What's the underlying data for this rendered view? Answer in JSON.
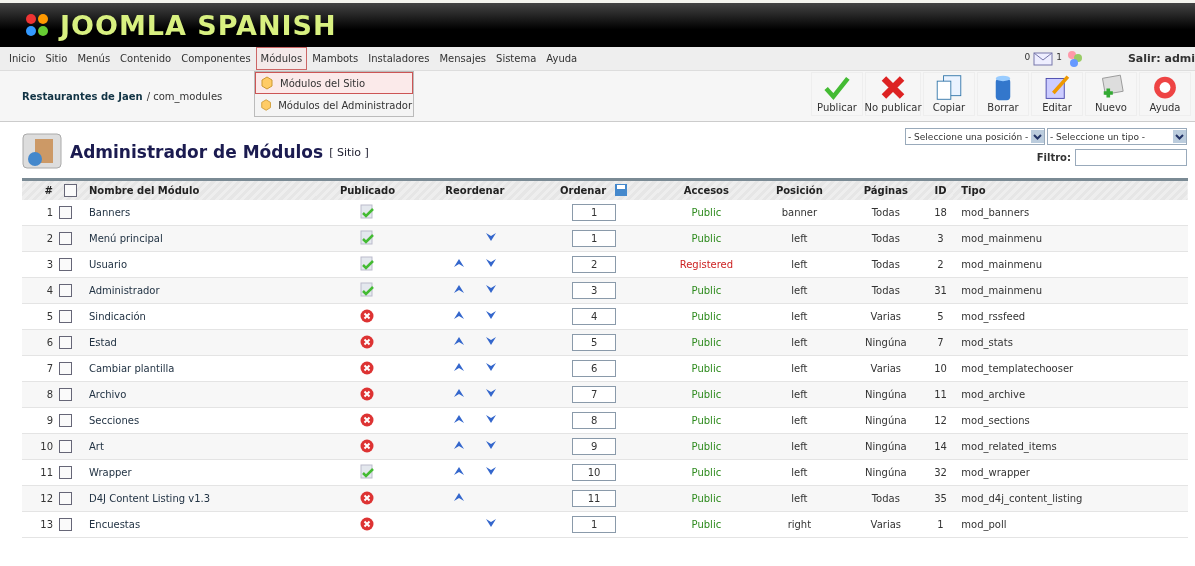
{
  "header": {
    "title": "JOOMLA SPANISH"
  },
  "menu": {
    "items": [
      {
        "label": "Inicio",
        "selected": false
      },
      {
        "label": "Sitio",
        "selected": false
      },
      {
        "label": "Menús",
        "selected": false
      },
      {
        "label": "Contenido",
        "selected": false
      },
      {
        "label": "Componentes",
        "selected": false
      },
      {
        "label": "Módulos",
        "selected": true
      },
      {
        "label": "Mambots",
        "selected": false
      },
      {
        "label": "Instaladores",
        "selected": false
      },
      {
        "label": "Mensajes",
        "selected": false
      },
      {
        "label": "Sistema",
        "selected": false
      },
      {
        "label": "Ayuda",
        "selected": false
      }
    ],
    "messages_count": "0",
    "users_count": "1",
    "logout": "Salir: admi"
  },
  "dropdown": [
    {
      "label": "Módulos del Sitio",
      "selected": true
    },
    {
      "label": "Módulos del Administrador",
      "selected": false
    }
  ],
  "breadcrumb": {
    "site": "Restaurantes de Jaen",
    "path": "/ com_modules"
  },
  "toolbar": [
    {
      "kind": "publish",
      "label": "Publicar"
    },
    {
      "kind": "unpublish",
      "label": "No publicar"
    },
    {
      "kind": "copy",
      "label": "Copiar"
    },
    {
      "kind": "delete",
      "label": "Borrar"
    },
    {
      "kind": "edit",
      "label": "Editar"
    },
    {
      "kind": "new",
      "label": "Nuevo"
    },
    {
      "kind": "help",
      "label": "Ayuda"
    }
  ],
  "page": {
    "title": "Administrador de Módulos",
    "subtitle": "[ Sitio ]",
    "position_select": "- Seleccione una posición -",
    "type_select": "- Seleccione un tipo -",
    "filter_label": "Filtro:"
  },
  "table": {
    "select_all_checked": false,
    "columns": [
      "#",
      "Nombre del Módulo",
      "Publicado",
      "Reordenar",
      "Ordenar",
      "Accesos",
      "Posición",
      "Páginas",
      "ID",
      "Tipo"
    ],
    "rows": [
      {
        "num": "1",
        "checked": false,
        "name": "Banners",
        "published": true,
        "up": false,
        "down": false,
        "order": "1",
        "access": "Public",
        "color": "#2e8b1e",
        "position": "banner",
        "pages": "Todas",
        "id": "18",
        "type": "mod_banners"
      },
      {
        "num": "2",
        "checked": false,
        "name": "Menú principal",
        "published": true,
        "up": false,
        "down": true,
        "order": "1",
        "access": "Public",
        "color": "#2e8b1e",
        "position": "left",
        "pages": "Todas",
        "id": "3",
        "type": "mod_mainmenu"
      },
      {
        "num": "3",
        "checked": false,
        "name": "Usuario",
        "published": true,
        "up": true,
        "down": true,
        "order": "2",
        "access": "Registered",
        "color": "#cc2222",
        "position": "left",
        "pages": "Todas",
        "id": "2",
        "type": "mod_mainmenu"
      },
      {
        "num": "4",
        "checked": false,
        "name": "Administrador",
        "published": true,
        "up": true,
        "down": true,
        "order": "3",
        "access": "Public",
        "color": "#2e8b1e",
        "position": "left",
        "pages": "Todas",
        "id": "31",
        "type": "mod_mainmenu"
      },
      {
        "num": "5",
        "checked": false,
        "name": "Sindicación",
        "published": false,
        "up": true,
        "down": true,
        "order": "4",
        "access": "Public",
        "color": "#2e8b1e",
        "position": "left",
        "pages": "Varias",
        "id": "5",
        "type": "mod_rssfeed"
      },
      {
        "num": "6",
        "checked": false,
        "name": "Estad",
        "published": false,
        "up": true,
        "down": true,
        "order": "5",
        "access": "Public",
        "color": "#2e8b1e",
        "position": "left",
        "pages": "Ningúna",
        "id": "7",
        "type": "mod_stats"
      },
      {
        "num": "7",
        "checked": false,
        "name": "Cambiar plantilla",
        "published": false,
        "up": true,
        "down": true,
        "order": "6",
        "access": "Public",
        "color": "#2e8b1e",
        "position": "left",
        "pages": "Varias",
        "id": "10",
        "type": "mod_templatechooser"
      },
      {
        "num": "8",
        "checked": false,
        "name": "Archivo",
        "published": false,
        "up": true,
        "down": true,
        "order": "7",
        "access": "Public",
        "color": "#2e8b1e",
        "position": "left",
        "pages": "Ningúna",
        "id": "11",
        "type": "mod_archive"
      },
      {
        "num": "9",
        "checked": false,
        "name": "Secciones",
        "published": false,
        "up": true,
        "down": true,
        "order": "8",
        "access": "Public",
        "color": "#2e8b1e",
        "position": "left",
        "pages": "Ningúna",
        "id": "12",
        "type": "mod_sections"
      },
      {
        "num": "10",
        "checked": false,
        "name": "Art",
        "published": false,
        "up": true,
        "down": true,
        "order": "9",
        "access": "Public",
        "color": "#2e8b1e",
        "position": "left",
        "pages": "Ningúna",
        "id": "14",
        "type": "mod_related_items"
      },
      {
        "num": "11",
        "checked": false,
        "name": "Wrapper",
        "published": true,
        "up": true,
        "down": true,
        "order": "10",
        "access": "Public",
        "color": "#2e8b1e",
        "position": "left",
        "pages": "Ningúna",
        "id": "32",
        "type": "mod_wrapper"
      },
      {
        "num": "12",
        "checked": false,
        "name": "D4J Content Listing v1.3",
        "published": false,
        "up": true,
        "down": false,
        "order": "11",
        "access": "Public",
        "color": "#2e8b1e",
        "position": "left",
        "pages": "Todas",
        "id": "35",
        "type": "mod_d4j_content_listing"
      },
      {
        "num": "13",
        "checked": false,
        "name": "Encuestas",
        "published": false,
        "up": false,
        "down": true,
        "order": "1",
        "access": "Public",
        "color": "#2e8b1e",
        "position": "right",
        "pages": "Varias",
        "id": "1",
        "type": "mod_poll"
      }
    ]
  }
}
